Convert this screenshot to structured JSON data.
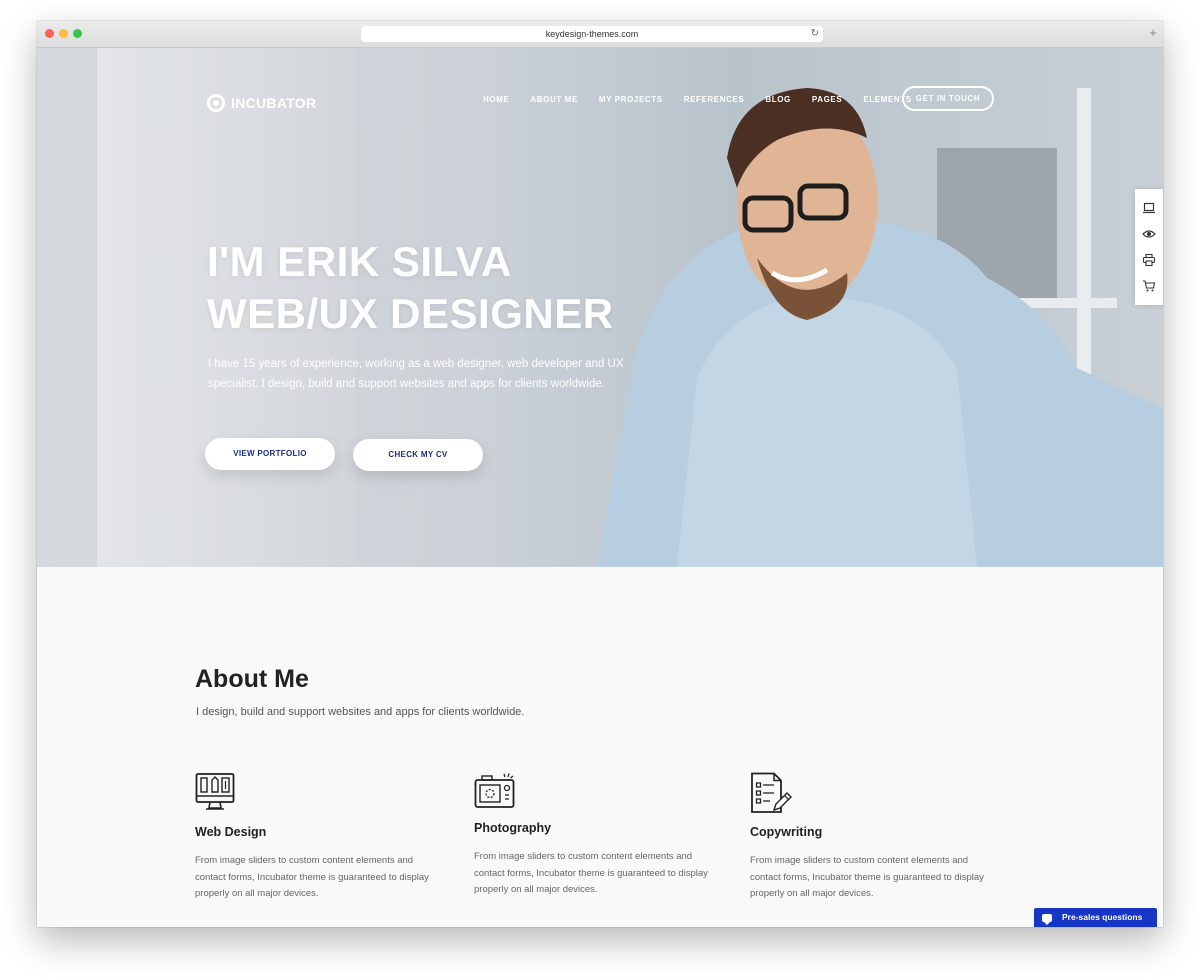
{
  "browser": {
    "url": "keydesign-themes.com",
    "reload_glyph": "↻",
    "new_tab_glyph": "+"
  },
  "site": {
    "logo": "INCUBATOR",
    "nav": [
      "HOME",
      "ABOUT ME",
      "MY PROJECTS",
      "REFERENCES",
      "BLOG",
      "PAGES",
      "ELEMENTS"
    ],
    "cta": "GET IN TOUCH"
  },
  "hero": {
    "title_line1": "I'M ERIK SILVA",
    "title_line2": "WEB/UX DESIGNER",
    "desc_line1": "I have 15 years of experience, working as a web designer, web developer and UX",
    "desc_line2": "specialist. I design, build and support websites and apps for clients worldwide.",
    "btn_portfolio": "VIEW PORTFOLIO",
    "btn_cv": "CHECK MY CV"
  },
  "side_tools": [
    "laptop-icon",
    "eye-icon",
    "printer-icon",
    "cart-icon"
  ],
  "about": {
    "title": "About Me",
    "subtitle": "I design, build and support websites and apps for clients worldwide.",
    "features": [
      {
        "title": "Web Design",
        "icon": "web-design-icon",
        "text": "From image sliders to custom content elements and contact forms, Incubator theme is guaranteed to display properly on all major devices."
      },
      {
        "title": "Photography",
        "icon": "camera-icon",
        "text": "From image sliders to custom content elements and contact forms, Incubator theme is guaranteed to display properly on all major devices."
      },
      {
        "title": "Copywriting",
        "icon": "document-pen-icon",
        "text": "From image sliders to custom content elements and contact forms, Incubator theme is guaranteed to display properly on all major devices."
      }
    ]
  },
  "chat": {
    "label": "Pre-sales questions"
  },
  "colors": {
    "accent": "#1736c6",
    "button_text": "#1b2d8a"
  }
}
